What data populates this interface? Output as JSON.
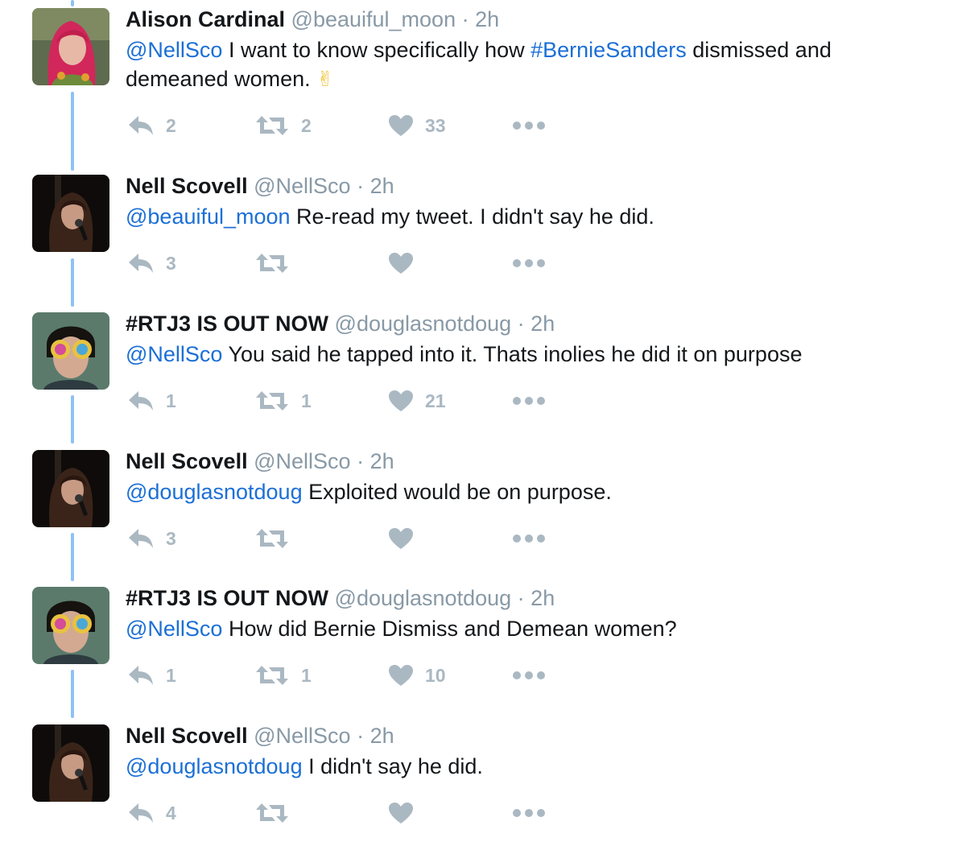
{
  "tweets": [
    {
      "name": "Alison Cardinal",
      "handle": "@beauiful_moon",
      "dot": "·",
      "time": "2h",
      "text_mention": "@NellSco",
      "text_part1": " I want to know specifically how ",
      "text_hashtag": "#BernieSanders",
      "text_part2": " dismissed and demeaned women. ",
      "emoji": "✌",
      "reply_count": "2",
      "retweet_count": "2",
      "like_count": "33",
      "avatar": "woman-red-hair"
    },
    {
      "name": "Nell Scovell",
      "handle": "@NellSco",
      "dot": "·",
      "time": "2h",
      "text_mention": "@beauiful_moon",
      "text_rest": " Re-read my tweet. I didn't say he did.",
      "reply_count": "3",
      "retweet_count": "",
      "like_count": "",
      "avatar": "woman-microphone"
    },
    {
      "name": "#RTJ3 IS OUT NOW",
      "handle": "@douglasnotdoug",
      "dot": "·",
      "time": "2h",
      "text_mention": "@NellSco",
      "text_rest": " You said he tapped into it. Thats inolies he did it on purpose",
      "reply_count": "1",
      "retweet_count": "1",
      "like_count": "21",
      "avatar": "man-colorful-glasses"
    },
    {
      "name": "Nell Scovell",
      "handle": "@NellSco",
      "dot": "·",
      "time": "2h",
      "text_mention": "@douglasnotdoug",
      "text_rest": " Exploited would be on purpose.",
      "reply_count": "3",
      "retweet_count": "",
      "like_count": "",
      "avatar": "woman-microphone"
    },
    {
      "name": "#RTJ3 IS OUT NOW",
      "handle": "@douglasnotdoug",
      "dot": "·",
      "time": "2h",
      "text_mention": "@NellSco",
      "text_rest": " How did Bernie Dismiss and Demean women?",
      "reply_count": "1",
      "retweet_count": "1",
      "like_count": "10",
      "avatar": "man-colorful-glasses"
    },
    {
      "name": "Nell Scovell",
      "handle": "@NellSco",
      "dot": "·",
      "time": "2h",
      "text_mention": "@douglasnotdoug",
      "text_rest": " I didn't say he did.",
      "reply_count": "4",
      "retweet_count": "",
      "like_count": "",
      "avatar": "woman-microphone"
    }
  ],
  "icons": {
    "reply": "reply-icon",
    "retweet": "retweet-icon",
    "like": "heart-icon",
    "more": "more-dots-icon"
  },
  "colors": {
    "mention": "#1b6fd6",
    "handle": "#8899a6",
    "icon": "#aab8c2",
    "thread_line": "#8ec1f5"
  }
}
